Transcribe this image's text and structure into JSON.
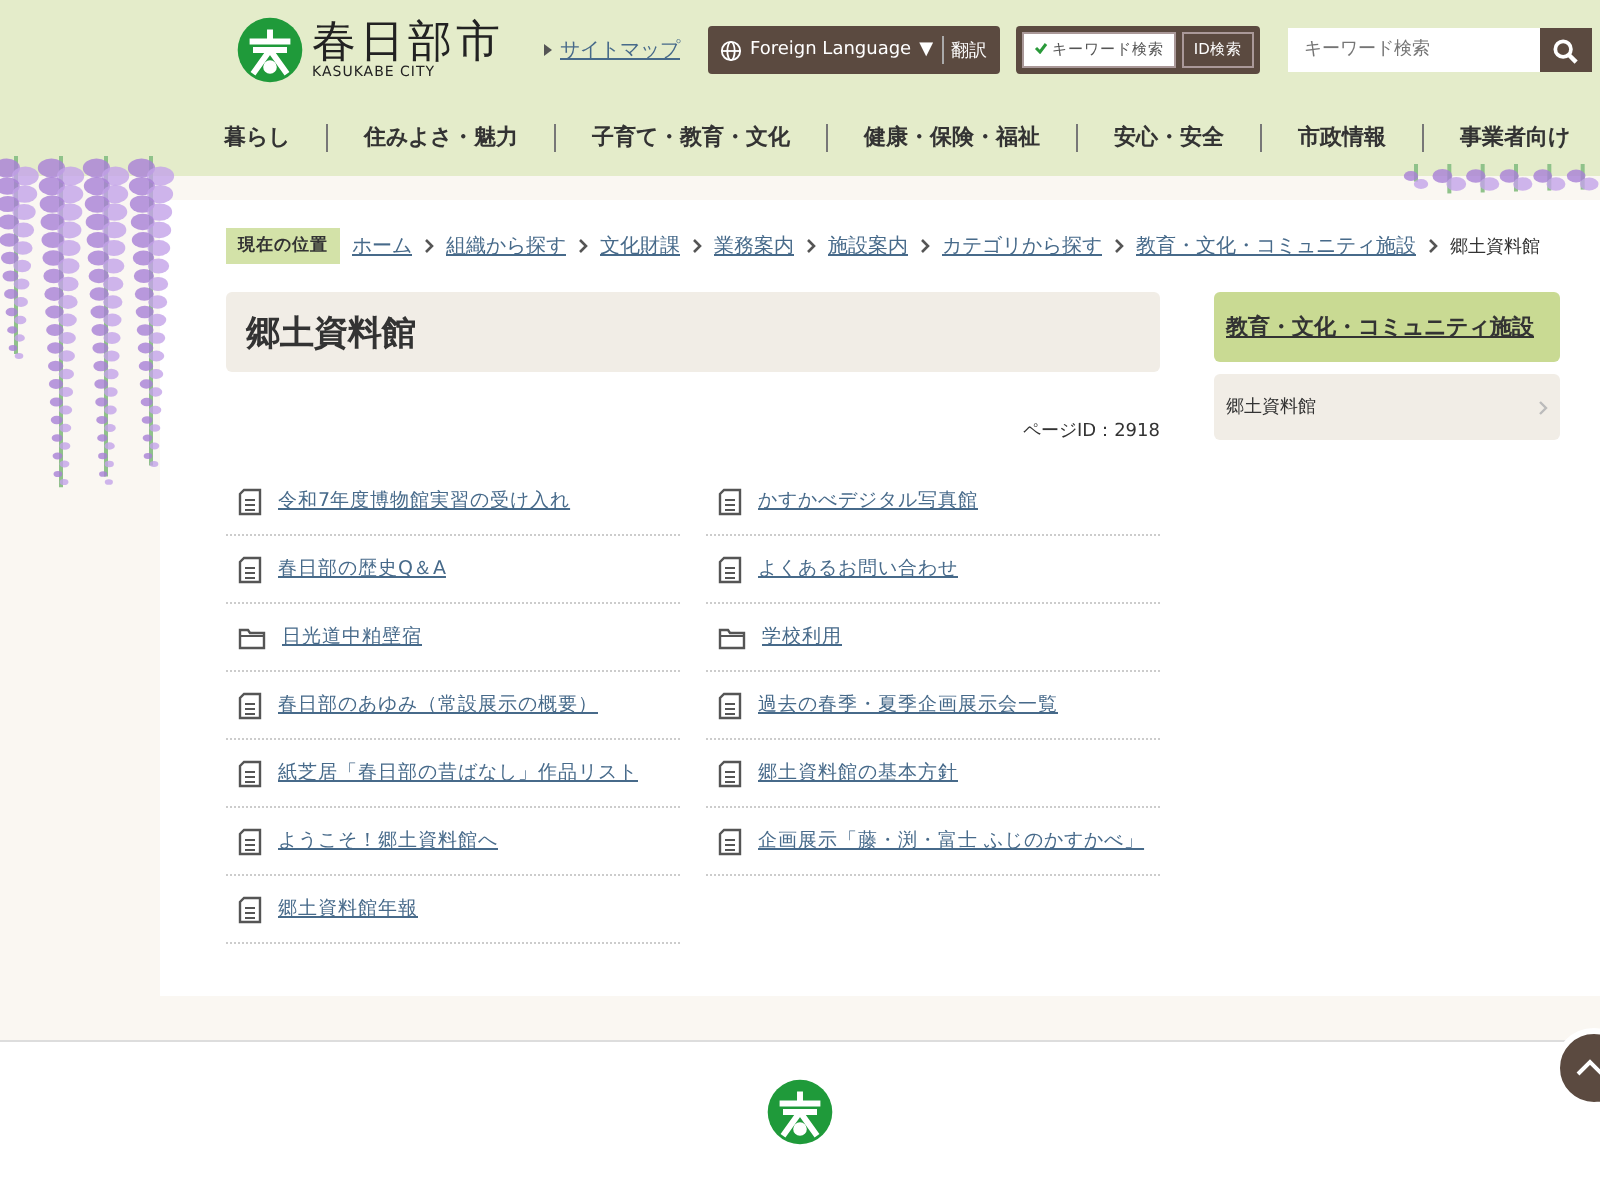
{
  "header": {
    "logo_text": "春日部市",
    "logo_subtext": "KASUKABE CITY",
    "sitemap_link": "サイトマップ",
    "foreign_language": "Foreign Language",
    "foreign_caret": "▼",
    "translate": "翻訳",
    "search_modes": [
      {
        "label": "キーワード検索",
        "selected": true
      },
      {
        "label": "ID検索",
        "selected": false
      }
    ],
    "search": {
      "placeholder": "キーワード検索"
    }
  },
  "nav": [
    "暮らし",
    "住みよさ・魅力",
    "子育て・教育・文化",
    "健康・保険・福祉",
    "安心・安全",
    "市政情報",
    "事業者向け"
  ],
  "breadcrumb": {
    "label": "現在の位置",
    "links": [
      "ホーム",
      "組織から探す",
      "文化財課",
      "業務案内",
      "施設案内",
      "カテゴリから探す",
      "教育・文化・コミュニティ施設"
    ],
    "current": "郷土資料館"
  },
  "page": {
    "title": "郷土資料館",
    "page_id": "ページID：2918",
    "items": [
      {
        "kind": "doc",
        "label": "令和7年度博物館実習の受け入れ"
      },
      {
        "kind": "doc",
        "label": "かすかべデジタル写真館"
      },
      {
        "kind": "doc",
        "label": "春日部の歴史Q＆A"
      },
      {
        "kind": "doc",
        "label": "よくあるお問い合わせ"
      },
      {
        "kind": "folder",
        "label": "日光道中粕壁宿"
      },
      {
        "kind": "folder",
        "label": "学校利用"
      },
      {
        "kind": "doc",
        "label": "春日部のあゆみ（常設展示の概要）"
      },
      {
        "kind": "doc",
        "label": "過去の春季・夏季企画展示会一覧"
      },
      {
        "kind": "doc",
        "label": "紙芝居「春日部の昔ばなし」作品リスト"
      },
      {
        "kind": "doc",
        "label": "郷土資料館の基本方針"
      },
      {
        "kind": "doc",
        "label": "ようこそ！郷土資料館へ"
      },
      {
        "kind": "doc",
        "label": "企画展示「藤・渕・富士 ふじのかすかべ」"
      },
      {
        "kind": "doc",
        "label": "郷土資料館年報"
      }
    ]
  },
  "sidebar": {
    "heading": "教育・文化・コミュニティ施設",
    "items": [
      {
        "label": "郷土資料館",
        "selected": true
      }
    ]
  }
}
